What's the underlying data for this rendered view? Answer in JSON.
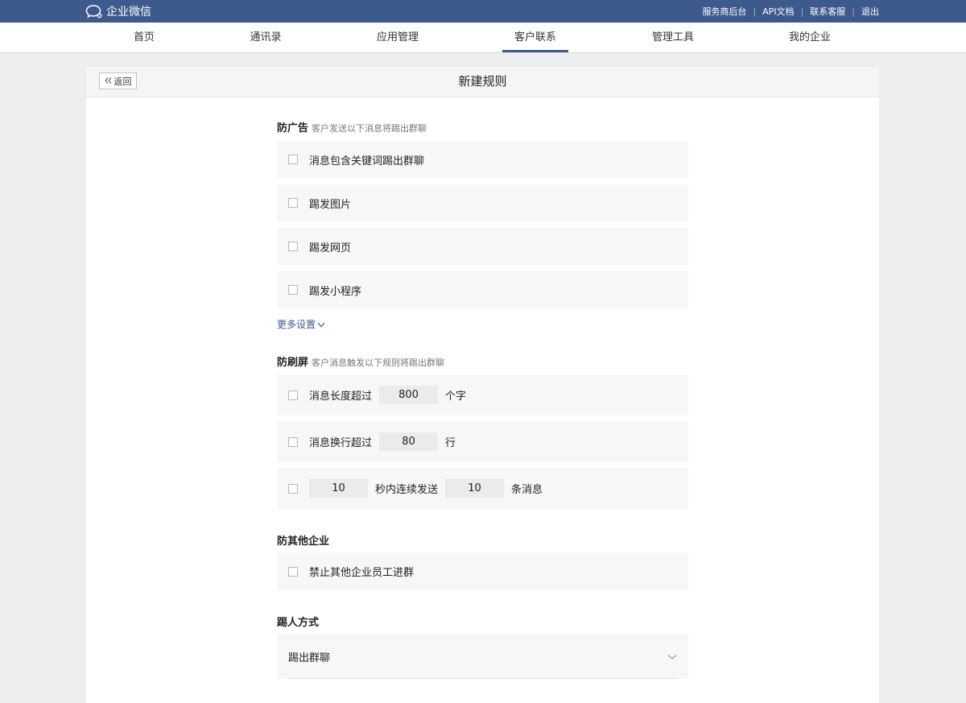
{
  "brand": {
    "name": "企业微信"
  },
  "top_links": [
    "服务商后台",
    "API文档",
    "联系客服",
    "退出"
  ],
  "nav": {
    "items": [
      "首页",
      "通讯录",
      "应用管理",
      "客户联系",
      "管理工具",
      "我的企业"
    ],
    "active": "客户联系"
  },
  "panel": {
    "back_label": "返回",
    "title": "新建规则"
  },
  "anti_ad": {
    "title": "防广告",
    "desc": "客户发送以下消息将踢出群聊",
    "options": [
      "消息包含关键词踢出群聊",
      "踢发图片",
      "踢发网页",
      "踢发小程序"
    ],
    "more_label": "更多设置"
  },
  "anti_spam": {
    "title": "防刷屏",
    "desc": "客户消息触发以下规则将踢出群聊",
    "length": {
      "prefix": "消息长度超过",
      "value": "800",
      "suffix": "个字"
    },
    "lines": {
      "prefix": "消息换行超过",
      "value": "80",
      "suffix": "行"
    },
    "rate": {
      "seconds": "10",
      "middle": "秒内连续发送",
      "count": "10",
      "suffix": "条消息"
    }
  },
  "anti_other": {
    "title": "防其他企业",
    "option": "禁止其他企业员工进群"
  },
  "kick_method": {
    "title": "踢人方式",
    "selected": "踢出群聊"
  },
  "colors": {
    "topbar": "#3d5a8c",
    "accent": "#3d5a8c",
    "row_bg": "#f7f7f7"
  }
}
